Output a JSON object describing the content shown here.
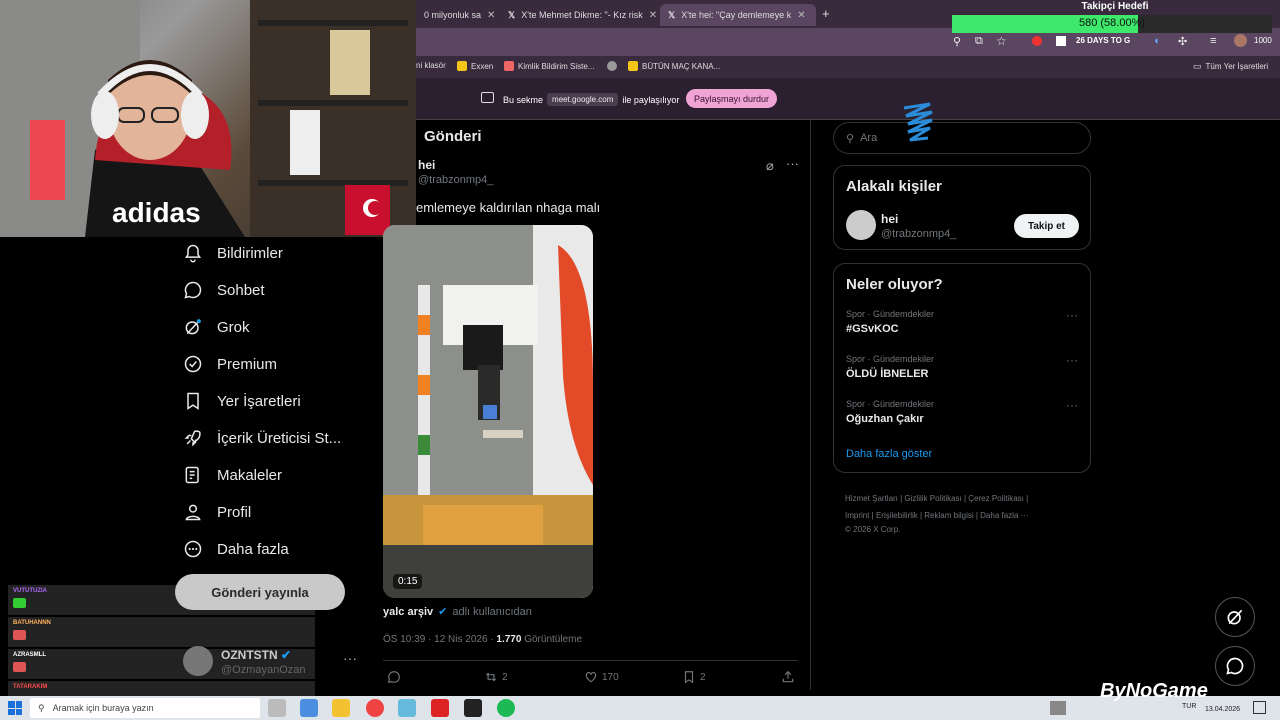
{
  "browser": {
    "tabs": [
      {
        "label": "0 milyonluk sa"
      },
      {
        "label": "X'te Mehmet Dikme: \"- Kız risk"
      },
      {
        "label": "X'te hei: \"Çay demlemeye k"
      }
    ],
    "new_tab": "+",
    "address_extra": "26 DAYS TO G",
    "profile_count": "1000",
    "bookmarks": [
      {
        "label": "ni klasör"
      },
      {
        "label": "Exxen"
      },
      {
        "label": "Kimlik Bildirim Siste..."
      },
      {
        "label": "BÜTÜN MAÇ KANA..."
      }
    ],
    "all_bookmarks": "Tüm Yer İşaretleri",
    "share": {
      "prefix": "Bu sekme",
      "url": "meet.google.com",
      "suffix": "ile paylaşılıyor",
      "stop": "Paylaşmayı durdur"
    }
  },
  "overlay": {
    "follower_title": "Takipçi Hedefi",
    "follower_text": "580 (58.00%)",
    "progress": 0.58,
    "colors": {
      "bar_fill": "#3ee86a"
    }
  },
  "nav": {
    "items": [
      {
        "label": "Bildirimler",
        "icon": "bell-icon"
      },
      {
        "label": "Sohbet",
        "icon": "chat-icon"
      },
      {
        "label": "Grok",
        "icon": "grok-icon"
      },
      {
        "label": "Premium",
        "icon": "verified-icon"
      },
      {
        "label": "Yer İşaretleri",
        "icon": "bookmark-icon"
      },
      {
        "label": "İçerik Üreticisi St...",
        "icon": "rocket-icon"
      },
      {
        "label": "Makaleler",
        "icon": "article-icon"
      },
      {
        "label": "Profil",
        "icon": "person-icon"
      },
      {
        "label": "Daha fazla",
        "icon": "more-circle-icon"
      }
    ],
    "post_button": "Gönderi yayınla",
    "profile": {
      "name": "OZNTSTN",
      "handle": "@OzmayanOzan",
      "more": "···"
    }
  },
  "chat": [
    {
      "name": "VUTUTUZIA",
      "color": "#b06bff"
    },
    {
      "name": "BATUHANNN",
      "color": "#ffb35c"
    },
    {
      "name": "AZRASMLL",
      "color": "#ffffff"
    },
    {
      "name": "TATARAKIM",
      "color": "#ff4d4d"
    }
  ],
  "post": {
    "header": "Gönderi",
    "author_name": "hei",
    "author_handle": "@trabzonmp4_",
    "text": "emlemeye kaldırılan nhaga malı",
    "video_duration": "0:15",
    "source_user": "yalc arşiv",
    "source_suffix": "adlı kullanıcıdan",
    "time": "ÖS 10:39 · 12 Nis 2026 · ",
    "views": "1.770",
    "views_label": " Görüntüleme",
    "replies": "",
    "reposts": "2",
    "likes": "170",
    "bookmarks": "2"
  },
  "sidebar": {
    "search_placeholder": "Ara",
    "related_title": "Alakalı kişiler",
    "related": {
      "name": "hei",
      "handle": "@trabzonmp4_",
      "follow": "Takip et"
    },
    "trends_title": "Neler oluyor?",
    "trends": [
      {
        "category": "Spor · Gündemdekiler",
        "name": "#GSvKOC"
      },
      {
        "category": "Spor · Gündemdekiler",
        "name": "ÖLDÜ İBNELER"
      },
      {
        "category": "Spor · Gündemdekiler",
        "name": "Oğuzhan Çakır"
      }
    ],
    "show_more": "Daha fazla göster",
    "footer": {
      "line1": "Hizmet Şartları  |  Gizlilik Politikası  |  Çerez Politikası  |",
      "line2": "Imprint  |  Erişilebilirlik  |  Reklam bilgisi  |  Daha fazla ···",
      "line3": "© 2026 X Corp."
    }
  },
  "taskbar": {
    "search_placeholder": "Aramak için buraya yazın",
    "lang": "TUR",
    "date": "13.04.2026"
  },
  "watermark": "ByNoGame"
}
